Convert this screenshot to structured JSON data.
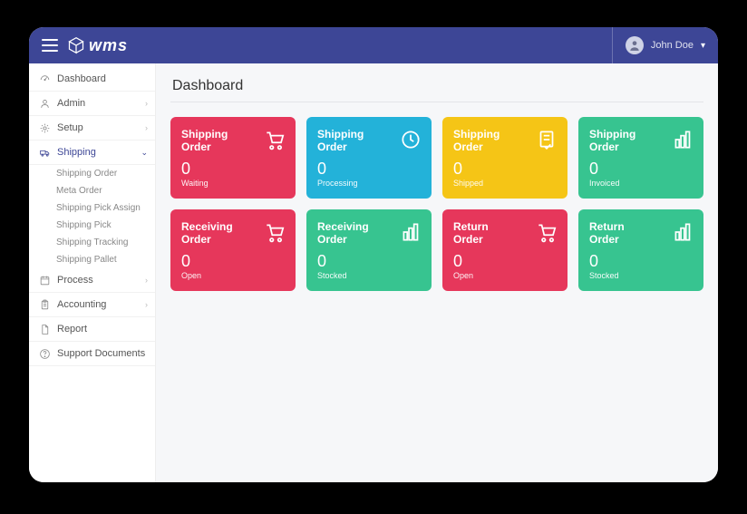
{
  "header": {
    "logo_text": "wms",
    "user_name": "John Doe"
  },
  "page": {
    "title": "Dashboard"
  },
  "sidebar": {
    "items": [
      {
        "label": "Dashboard",
        "icon": "gauge-icon",
        "expandable": false,
        "active": false
      },
      {
        "label": "Admin",
        "icon": "user-icon",
        "expandable": true,
        "active": false
      },
      {
        "label": "Setup",
        "icon": "gear-icon",
        "expandable": true,
        "active": false
      },
      {
        "label": "Shipping",
        "icon": "truck-icon",
        "expandable": true,
        "active": true,
        "children": [
          "Shipping Order",
          "Meta Order",
          "Shipping Pick Assign",
          "Shipping Pick",
          "Shipping Tracking",
          "Shipping Pallet"
        ]
      },
      {
        "label": "Process",
        "icon": "calendar-icon",
        "expandable": true,
        "active": false
      },
      {
        "label": "Accounting",
        "icon": "clipboard-icon",
        "expandable": true,
        "active": false
      },
      {
        "label": "Report",
        "icon": "file-icon",
        "expandable": false,
        "active": false
      },
      {
        "label": "Support Documents",
        "icon": "help-icon",
        "expandable": false,
        "active": false
      }
    ]
  },
  "cards": [
    {
      "title": "Shipping Order",
      "value": "0",
      "status": "Waiting",
      "color": "c-pink",
      "icon": "cart-icon"
    },
    {
      "title": "Shipping Order",
      "value": "0",
      "status": "Processing",
      "color": "c-blue",
      "icon": "processing-icon"
    },
    {
      "title": "Shipping Order",
      "value": "0",
      "status": "Shipped",
      "color": "c-yellow",
      "icon": "receipt-icon"
    },
    {
      "title": "Shipping Order",
      "value": "0",
      "status": "Invoiced",
      "color": "c-green",
      "icon": "bars-icon"
    },
    {
      "title": "Receiving Order",
      "value": "0",
      "status": "Open",
      "color": "c-pink",
      "icon": "cart-icon"
    },
    {
      "title": "Receiving Order",
      "value": "0",
      "status": "Stocked",
      "color": "c-green",
      "icon": "bars-icon"
    },
    {
      "title": "Return Order",
      "value": "0",
      "status": "Open",
      "color": "c-pink",
      "icon": "cart-icon"
    },
    {
      "title": "Return Order",
      "value": "0",
      "status": "Stocked",
      "color": "c-green",
      "icon": "bars-icon"
    }
  ],
  "colors": {
    "brand": "#3d4696",
    "pink": "#e6375b",
    "blue": "#23b2d9",
    "yellow": "#f5c516",
    "green": "#37c490"
  }
}
